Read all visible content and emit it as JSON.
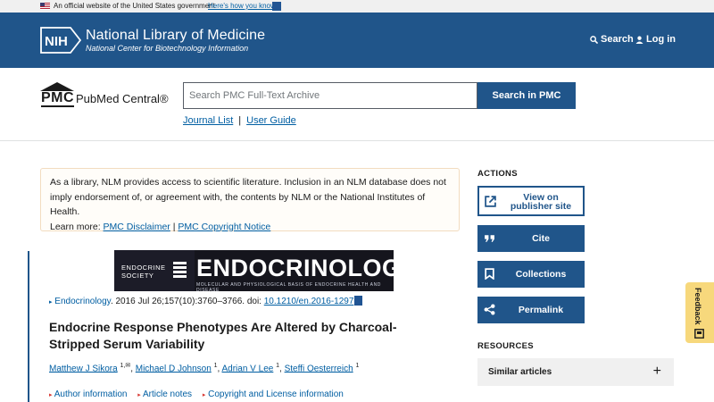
{
  "gov_banner": {
    "text": "An official website of the United States government",
    "link": "Here's how you know"
  },
  "header": {
    "org_mark": "NIH",
    "title": "National Library of Medicine",
    "subtitle": "National Center for Biotechnology Information",
    "search_label": "Search",
    "login_label": "Log in"
  },
  "pmc": {
    "logo_mark": "PMC",
    "logo_name": "PubMed Central®",
    "search_placeholder": "Search PMC Full-Text Archive",
    "search_button": "Search in PMC",
    "journal_list": "Journal List",
    "separator": "|",
    "user_guide": "User Guide"
  },
  "disclaimer": {
    "text": "As a library, NLM provides access to scientific literature. Inclusion in an NLM database does not imply endorsement of, or agreement with, the contents by NLM or the National Institutes of Health.",
    "learn_more": "Learn more:",
    "link1": "PMC Disclaimer",
    "sep": "|",
    "link2": "PMC Copyright Notice"
  },
  "journal_banner": {
    "society_line1": "ENDOCRINE",
    "society_line2": "SOCIETY",
    "journal_name": "ENDOCRINOLOGY",
    "tagline": "MOLECULAR AND PHYSIOLOGICAL BASIS OF ENDOCRINE HEALTH AND DISEASE"
  },
  "article": {
    "journal": "Endocrinology",
    "citation": ". 2016 Jul 26;157(10):3760–3766. doi: ",
    "doi": "10.1210/en.2016-1297",
    "title": "Endocrine Response Phenotypes Are Altered by Charcoal-Stripped Serum Variability",
    "authors": [
      {
        "name": "Matthew J Sikora",
        "sup": "1,✉"
      },
      {
        "name": "Michael D Johnson",
        "sup": "1"
      },
      {
        "name": "Adrian V Lee",
        "sup": "1"
      },
      {
        "name": "Steffi Oesterreich",
        "sup": "1"
      }
    ],
    "info_links": [
      "Author information",
      "Article notes",
      "Copyright and License information"
    ]
  },
  "sidebar": {
    "actions_heading": "ACTIONS",
    "view_on_publisher": "View on\npublisher site",
    "cite": "Cite",
    "collections": "Collections",
    "permalink": "Permalink",
    "resources_heading": "RESOURCES",
    "similar_articles": "Similar articles",
    "expand_symbol": "+"
  },
  "feedback": {
    "label": "Feedback"
  },
  "colors": {
    "primary": "#20558a",
    "link": "#005ea2",
    "feedback": "#f7d87c",
    "disclaimer_border": "#f2dcc0"
  }
}
